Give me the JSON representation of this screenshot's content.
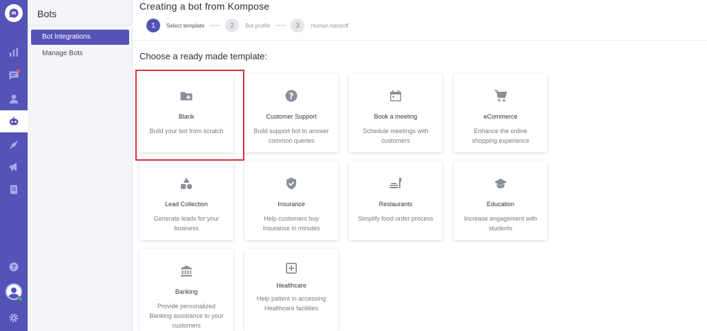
{
  "sidebar": {
    "title": "Bots",
    "items": [
      {
        "label": "Bot Integrations",
        "active": true
      },
      {
        "label": "Manage Bots",
        "active": false
      }
    ]
  },
  "rail": {
    "icons": [
      "logo-icon",
      "reports-icon",
      "conversations-icon",
      "contacts-icon",
      "bot-icon",
      "integrations-icon",
      "campaigns-icon",
      "knowledge-icon",
      "help-icon",
      "avatar",
      "settings-icon"
    ],
    "active": "bot-icon",
    "notification_color": "#e94d5f",
    "online_color": "#27c24c"
  },
  "header": {
    "title": "Creating a bot from Kompose",
    "steps": [
      {
        "number": "1",
        "label": "Select template",
        "active": true
      },
      {
        "number": "2",
        "label": "Bot profile",
        "active": false
      },
      {
        "number": "3",
        "label": "Human handoff",
        "active": false
      }
    ]
  },
  "main": {
    "section_title": "Choose a ready made template:",
    "templates": [
      {
        "title": "Blank",
        "description": "Build your bot from scratch",
        "icon": "folder-plus-icon",
        "highlighted": true
      },
      {
        "title": "Customer Support",
        "description": "Build support bot to answer common queries",
        "icon": "question-icon"
      },
      {
        "title": "Book a meeting",
        "description": "Schedule meetings with customers",
        "icon": "calendar-icon"
      },
      {
        "title": "eCommerce",
        "description": "Enhance the online shopping experience",
        "icon": "cart-icon"
      },
      {
        "title": "Lead Collection",
        "description": "Generate leads for your business",
        "icon": "shapes-icon"
      },
      {
        "title": "Insurance",
        "description": "Help customers buy insurance in minutes",
        "icon": "shield-check-icon"
      },
      {
        "title": "Restaurants",
        "description": "Simplify food order process",
        "icon": "food-icon"
      },
      {
        "title": "Education",
        "description": "Increase engagement with students",
        "icon": "graduation-cap-icon"
      },
      {
        "title": "Banking",
        "description": "Provide personalized Banking assistance to your customers",
        "icon": "bank-icon"
      },
      {
        "title": "Healthcare",
        "description": "Help patient in accessing Healthcare facilities",
        "icon": "medical-plus-icon"
      }
    ]
  },
  "colors": {
    "brand": "#5553b7",
    "highlight_border": "#d42f35",
    "icon_gray": "#8b8f99"
  }
}
